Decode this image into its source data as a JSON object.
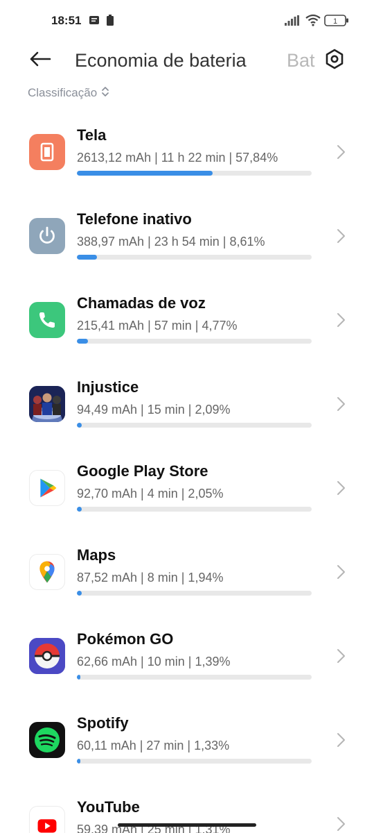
{
  "status": {
    "time": "18:51",
    "battery_level": "1"
  },
  "header": {
    "title": "Economia de bateria",
    "next_tab": "Bat",
    "icons": {
      "back": "back-arrow-icon",
      "settings": "gear-icon"
    }
  },
  "sort": {
    "label": "Classificação",
    "icon": "sort-chevrons-icon"
  },
  "items": [
    {
      "name": "Tela",
      "stats": "2613,12 mAh | 11 h 22 min  | 57,84%",
      "percent": 57.84,
      "icon": "screen-icon",
      "color": "#F47F5F"
    },
    {
      "name": "Telefone inativo",
      "stats": "388,97 mAh | 23 h 54 min  | 8,61%",
      "percent": 8.61,
      "icon": "power-icon",
      "color": "#8FA6BA"
    },
    {
      "name": "Chamadas de voz",
      "stats": "215,41 mAh | 57 min  | 4,77%",
      "percent": 4.77,
      "icon": "phone-icon",
      "color": "#3CC77C"
    },
    {
      "name": "Injustice",
      "stats": "94,49 mAh | 15 min  | 2,09%",
      "percent": 2.09,
      "icon": "injustice-app-icon",
      "color": "#2B3A7A"
    },
    {
      "name": "Google Play Store",
      "stats": "92,70 mAh | 4 min  | 2,05%",
      "percent": 2.05,
      "icon": "play-store-icon",
      "color": "#FFFFFF"
    },
    {
      "name": "Maps",
      "stats": "87,52 mAh | 8 min  | 1,94%",
      "percent": 1.94,
      "icon": "maps-icon",
      "color": "#FFFFFF"
    },
    {
      "name": "Pokémon GO",
      "stats": "62,66 mAh | 10 min  | 1,39%",
      "percent": 1.39,
      "icon": "pokeball-icon",
      "color": "#5A4FC9"
    },
    {
      "name": "Spotify",
      "stats": "60,11 mAh | 27 min  | 1,33%",
      "percent": 1.33,
      "icon": "spotify-icon",
      "color": "#111111"
    },
    {
      "name": "YouTube",
      "stats": "59,39 mAh | 25 min  | 1,31%",
      "percent": 1.31,
      "icon": "youtube-icon",
      "color": "#FF0000"
    }
  ]
}
